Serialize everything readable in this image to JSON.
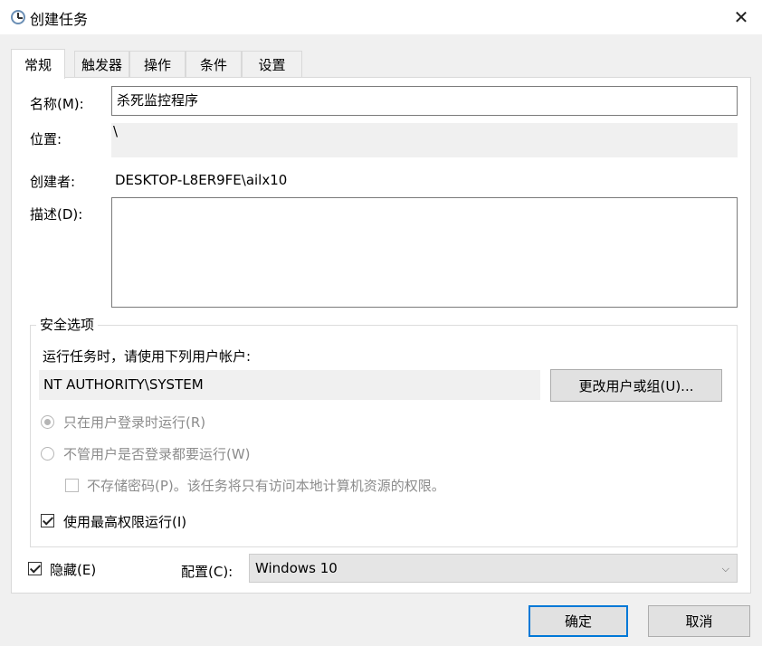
{
  "window": {
    "title": "创建任务",
    "close_glyph": "✕"
  },
  "tabs": [
    {
      "label": "常规",
      "active": true
    },
    {
      "label": "触发器"
    },
    {
      "label": "操作"
    },
    {
      "label": "条件"
    },
    {
      "label": "设置"
    }
  ],
  "general": {
    "name_label": "名称(M):",
    "name_value": "杀死监控程序",
    "location_label": "位置:",
    "location_value": "\\",
    "author_label": "创建者:",
    "author_value": "DESKTOP-L8ER9FE\\ailx10",
    "description_label": "描述(D):",
    "description_value": ""
  },
  "security": {
    "group_title": "安全选项",
    "run_as_prompt": "运行任务时，请使用下列用户帐户:",
    "account": "NT AUTHORITY\\SYSTEM",
    "change_user_button": "更改用户或组(U)...",
    "radio_logged_on": "只在用户登录时运行(R)",
    "radio_logged_on_checked": true,
    "radio_whether_logged": "不管用户是否登录都要运行(W)",
    "no_store_password": "不存储密码(P)。该任务将只有访问本地计算机资源的权限。",
    "highest_privileges": "使用最高权限运行(I)",
    "highest_privileges_checked": true
  },
  "footer_options": {
    "hidden_label": "隐藏(E)",
    "hidden_checked": true,
    "configure_label": "配置(C):",
    "configure_value": "Windows 10",
    "chevron_glyph": "⌵"
  },
  "dialog_buttons": {
    "ok": "确定",
    "cancel": "取消"
  },
  "colors": {
    "accent": "#0078d7",
    "panel_bg": "#ffffff",
    "window_bg": "#f0f0f0"
  }
}
